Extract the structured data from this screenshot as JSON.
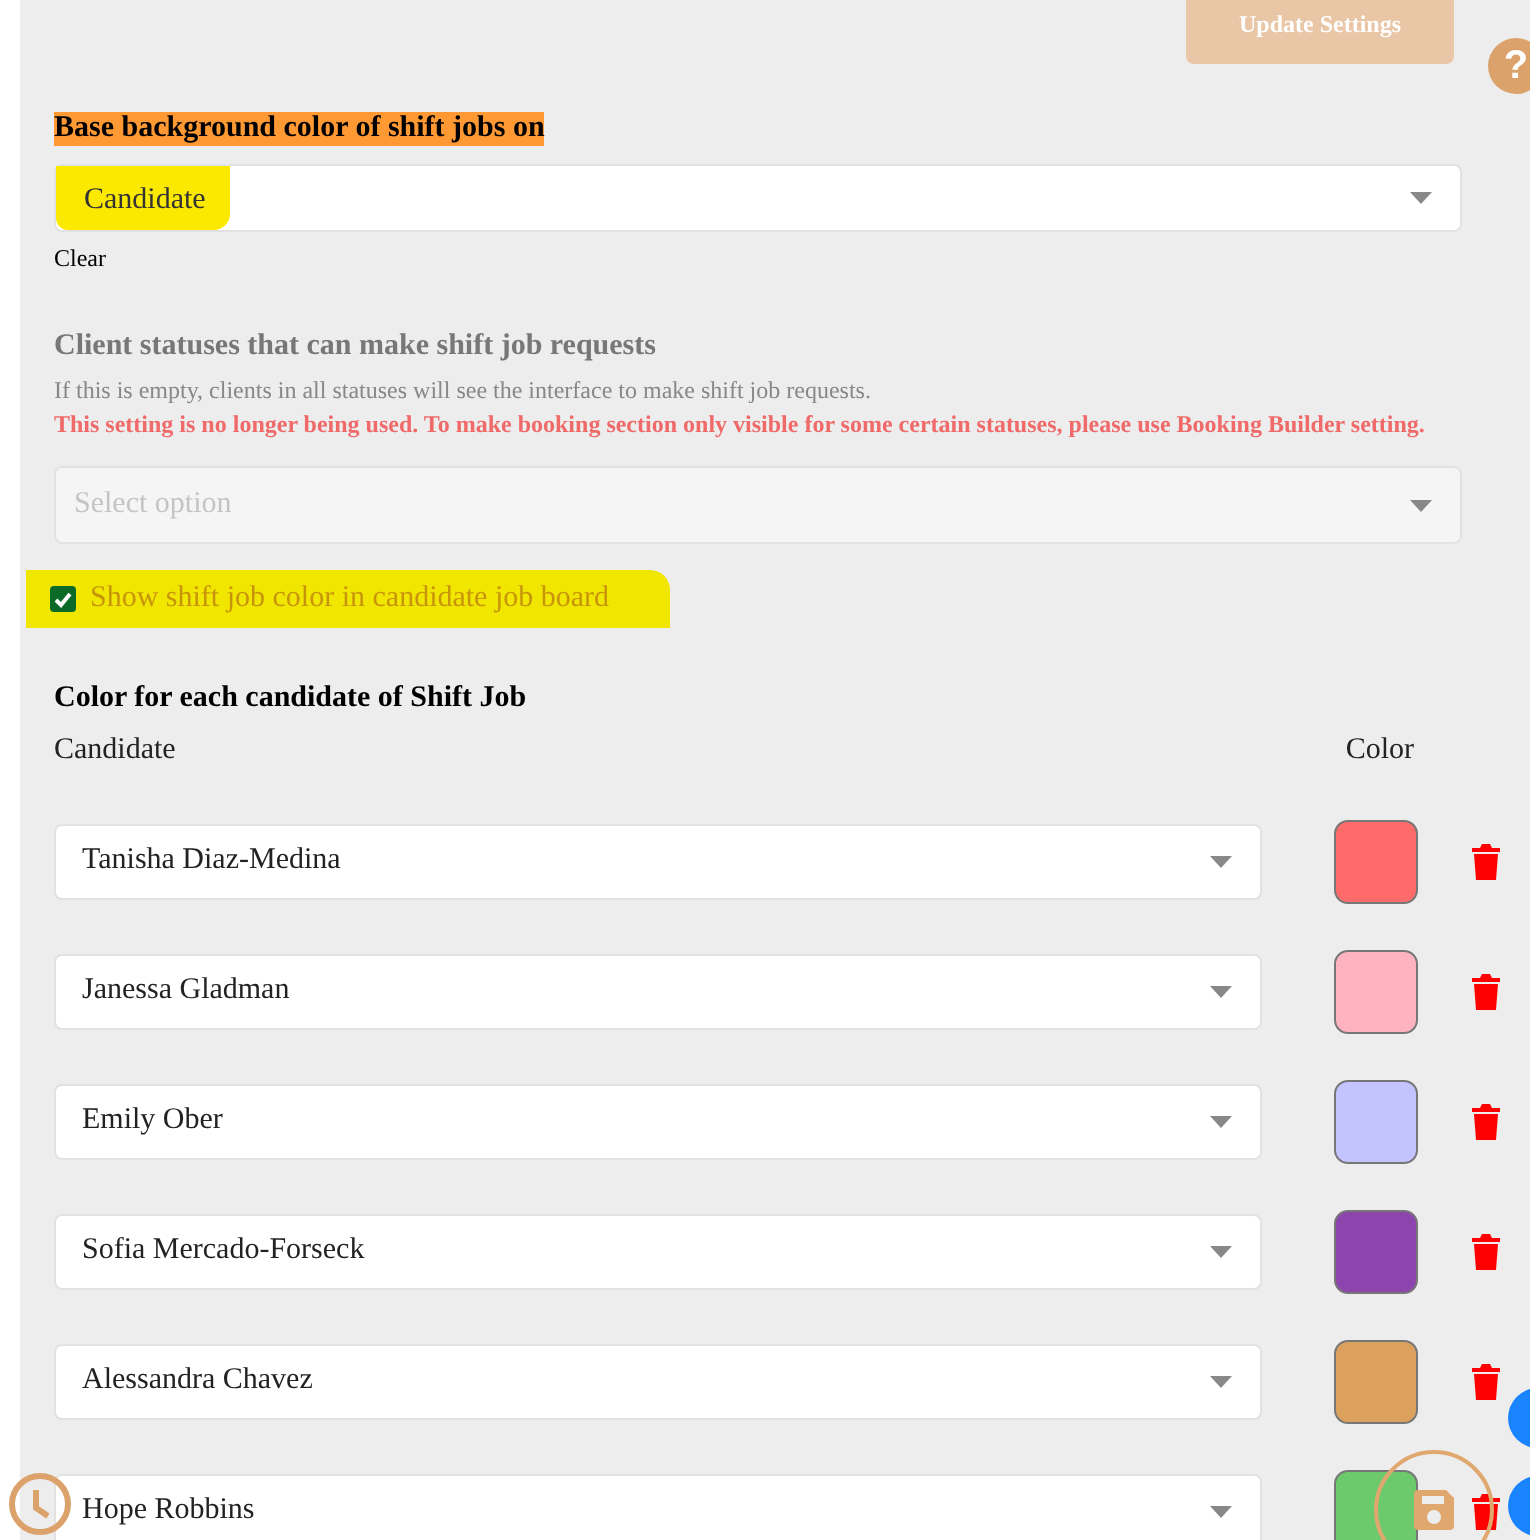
{
  "update_button": {
    "label": "Update Settings"
  },
  "help": {
    "label": "?"
  },
  "base_color": {
    "label": "Base background color of shift jobs on",
    "value": "Candidate",
    "clear": "Clear"
  },
  "client_statuses": {
    "label": "Client statuses that can make shift job requests",
    "hint": "If this is empty, clients in all statuses will see the interface to make shift job requests.",
    "warning": "This setting is no longer being used. To make booking section only visible for some certain statuses, please use Booking Builder setting.",
    "placeholder": "Select option"
  },
  "show_color": {
    "label": "Show shift job color in candidate job board",
    "checked": true
  },
  "candidate_colors": {
    "title": "Color for each candidate of Shift Job",
    "columns": [
      "Candidate",
      "Color"
    ],
    "rows": [
      {
        "name": "Tanisha Diaz-Medina",
        "color": "#ff6b6b"
      },
      {
        "name": "Janessa Gladman",
        "color": "#ffb3c1"
      },
      {
        "name": "Emily Ober",
        "color": "#c3c3ff"
      },
      {
        "name": "Sofia Mercado-Forseck",
        "color": "#8e44ad"
      },
      {
        "name": "Alessandra Chavez",
        "color": "#dda15e"
      },
      {
        "name": "Hope Robbins",
        "color": "#6cc96c"
      }
    ]
  }
}
